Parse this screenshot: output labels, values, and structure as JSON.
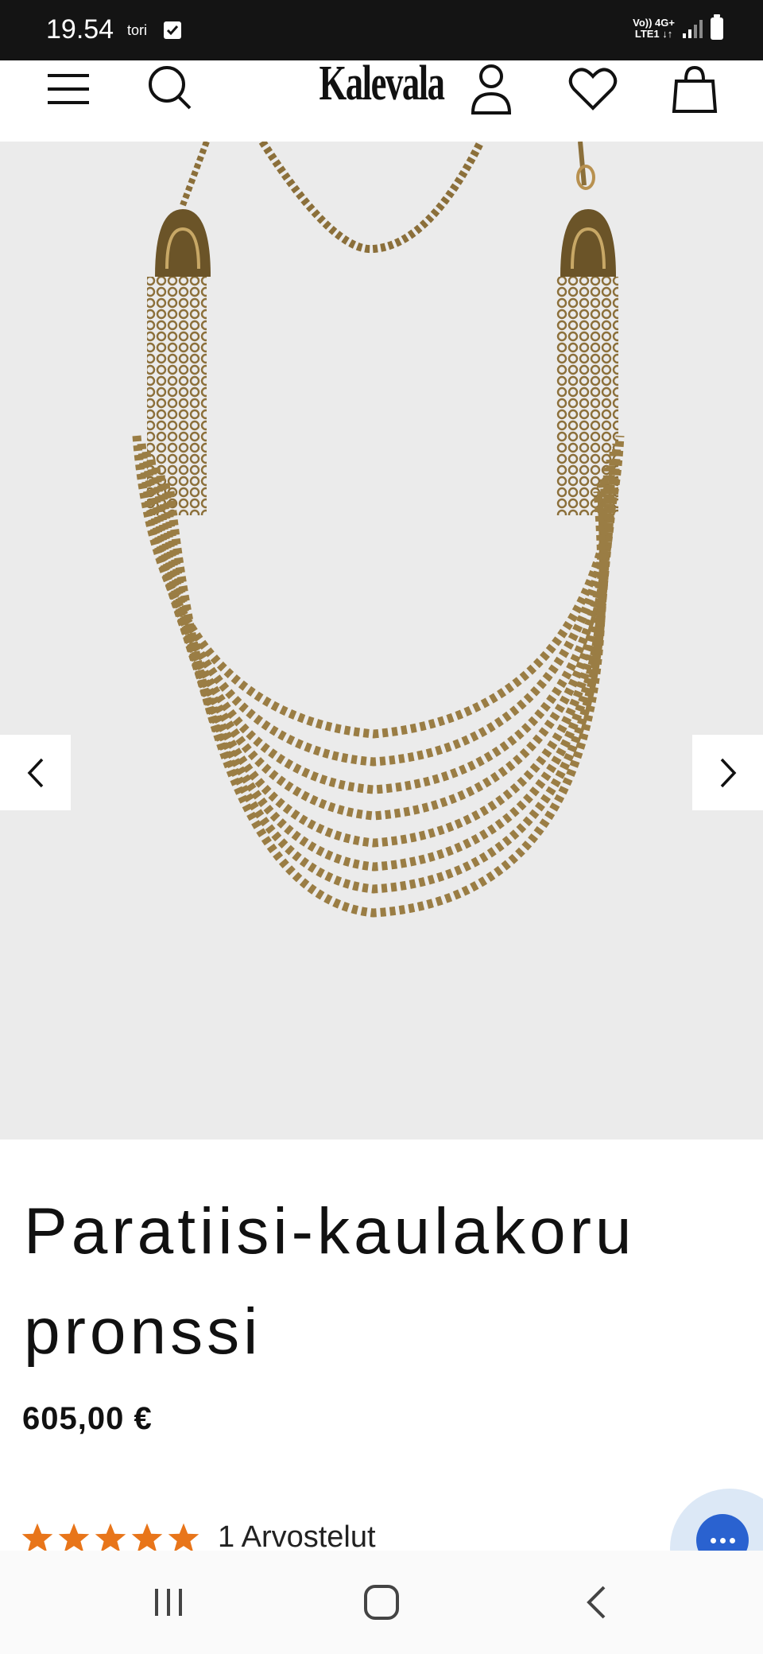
{
  "status_bar": {
    "time": "19.54",
    "day": "tori",
    "network_top": "Vo)) 4G+",
    "network_bottom": "LTE1 ↓↑"
  },
  "header": {
    "logo_text": "Kalevala",
    "icons": [
      "menu-icon",
      "search-icon",
      "account-icon",
      "wishlist-heart-icon",
      "shopping-bag-icon"
    ]
  },
  "product": {
    "title": "Paratiisi-kaulakoru pronssi",
    "price": "605,00 €",
    "rating": 5,
    "reviews_label": "1 Arvostelut"
  },
  "colors": {
    "star": "#e8751a",
    "chat_accent": "#2a62d0",
    "image_bg": "#ebebeb"
  }
}
